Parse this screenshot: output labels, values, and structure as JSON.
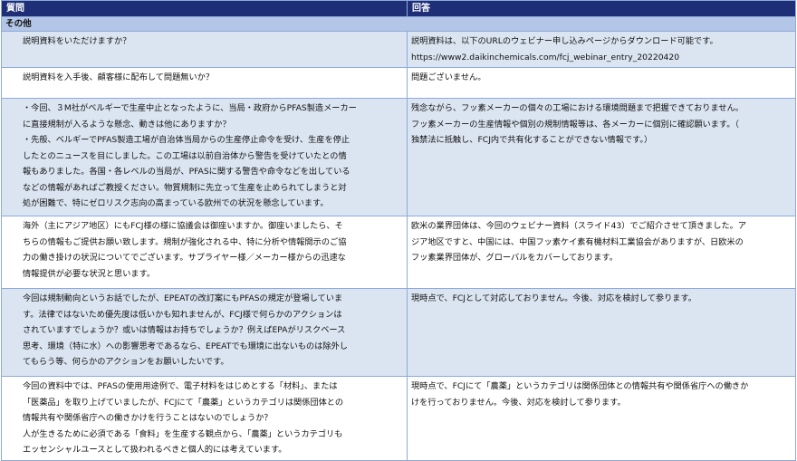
{
  "header": {
    "question": "質問",
    "answer": "回答"
  },
  "section": "その他",
  "rows": [
    {
      "q": [
        "説明資料をいただけますか？"
      ],
      "a": [
        "説明資料は、以下のURLのウェビナー申し込みページからダウンロード可能です。",
        "https://www2.daikinchemicals.com/fcj_webinar_entry_20220420"
      ]
    },
    {
      "q": [
        "説明資料を入手後、顧客様に配布して問題無いか？"
      ],
      "a": [
        "問題ございません。"
      ]
    },
    {
      "q": [
        "・今回、３M社がベルギーで生産中止となったように、当局・政府からPFAS製造メーカー",
        "に直接規制が入るような懸念、動きは他にありますか？",
        "・先般、ベルギーでPFAS製造工場が自治体当局からの生産停止命令を受け、生産を停止",
        "したとのニュースを目にしました。この工場は以前自治体から警告を受けていたとの情",
        "報もありました。各国・各レベルの当局が、PFASに関する警告や命令などを出している",
        "などの情報があればご教授ください。物質規制に先立って生産を止められてしまうと対",
        "処が困難で、特にゼロリスク志向の高まっている欧州での状況を懸念しています。"
      ],
      "a": [
        "残念ながら、フッ素メーカーの個々の工場における環境問題まで把握できておりません。",
        "フッ素メーカーの生産情報や個別の規制情報等は、各メーカーに個別に確認願います。（",
        "独禁法に抵触し、FCJ内で共有化することができない情報です。）"
      ]
    },
    {
      "q": [
        "海外（主にアジア地区）にもFCJ様の様に協議会は御座いますか。御座いましたら、そ",
        "ちらの情報もご提供お願い致します。規制が強化される中、特に分析や情報開示のご協",
        "力の働き掛けの状況についてでございます。サプライヤー様／メーカー様からの迅速な",
        "情報提供が必要な状況と思います。"
      ],
      "a": [
        "欧米の業界団体は、今回のウェビナー資料（スライド43）でご紹介させて頂きました。ア",
        "ジア地区ですと、中国には、中国フッ素ケイ素有機材料工業協会がありますが、日欧米の",
        "フッ素業界団体が、グローバルをカバーしております。"
      ]
    },
    {
      "q": [
        "今回は規制動向というお話でしたが、EPEATの改訂案にもPFASの規定が登場していま",
        "す。法律ではないため優先度は低いかも知れませんが、FCJ様で何らかのアクションは",
        "されていますでしょうか？或いは情報はお持ちでしょうか？例えばEPAがリスクベース",
        "思考、環境（特に水）への影響思考であるなら、EPEATでも環境に出ないものは除外し",
        "てもらう等、何らかのアクションをお願いしたいです。"
      ],
      "a": [
        "現時点で、FCJとして対応しておりません。今後、対応を検討して参ります。"
      ]
    },
    {
      "q": [
        "今回の資料中では、PFASの使用用途例で、電子材料をはじめとする「材料」、または",
        "「医薬品」を取り上げていましたが、FCJにて「農薬」というカテゴリは関係団体との",
        "情報共有や関係省庁への働きかけを行うことはないのでしょうか？",
        "人が生きるために必須である「食料」を生産する観点から、「農薬」というカテゴリも",
        "エッセンシャルユースとして扱われるべきと個人的には考えています。"
      ],
      "a": [
        "現時点で、FCJにて「農薬」というカテゴリは関係団体との情報共有や関係省庁への働きか",
        "けを行っておりません。今後、対応を検討して参ります。"
      ]
    }
  ]
}
